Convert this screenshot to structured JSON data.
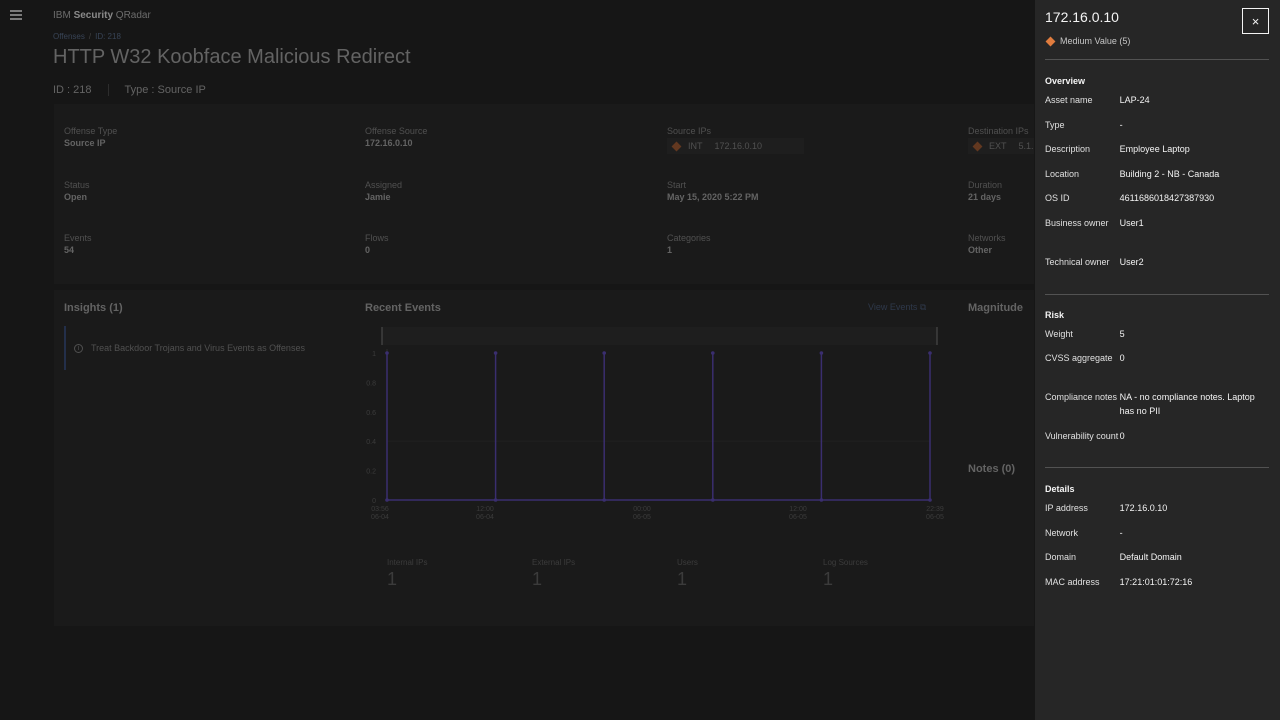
{
  "app": {
    "brand_prefix": "IBM ",
    "brand_bold": "Security",
    "brand_suffix": " QRadar"
  },
  "breadcrumb": {
    "root": "Offenses",
    "separator": "/",
    "current": "ID: 218"
  },
  "offense": {
    "title": "HTTP W32 Koobface Malicious Redirect",
    "id_label": "ID : 218",
    "type_label": "Type : Source IP",
    "fields": {
      "offense_type": {
        "label": "Offense Type",
        "value": "Source IP"
      },
      "offense_source": {
        "label": "Offense Source",
        "value": "172.16.0.10"
      },
      "source_ips": {
        "label": "Source IPs",
        "kind": "INT",
        "value": "172.16.0.10"
      },
      "destination_ips": {
        "label": "Destination IPs",
        "kind": "EXT",
        "value": "5.1..."
      },
      "status": {
        "label": "Status",
        "value": "Open"
      },
      "assigned": {
        "label": "Assigned",
        "value": "Jamie"
      },
      "start": {
        "label": "Start",
        "value": "May 15, 2020 5:22 PM"
      },
      "duration": {
        "label": "Duration",
        "value": "21 days"
      },
      "events": {
        "label": "Events",
        "value": "54"
      },
      "flows": {
        "label": "Flows",
        "value": "0"
      },
      "categories": {
        "label": "Categories",
        "value": "1"
      },
      "networks": {
        "label": "Networks",
        "value": "Other"
      }
    }
  },
  "insights": {
    "heading": "Insights (1)",
    "item": "Treat Backdoor Trojans and Virus Events as Offenses"
  },
  "recent_events": {
    "heading": "Recent Events",
    "view_link": "View Events"
  },
  "magnitude": {
    "heading": "Magnitude"
  },
  "notes": {
    "heading": "Notes (0)"
  },
  "stats": [
    {
      "label": "Internal IPs",
      "value": "1"
    },
    {
      "label": "External IPs",
      "value": "1"
    },
    {
      "label": "Users",
      "value": "1"
    },
    {
      "label": "Log Sources",
      "value": "1"
    }
  ],
  "chart_data": {
    "type": "line",
    "y_ticks": [
      "0",
      "0.2",
      "0.4",
      "0.6",
      "0.8",
      "1"
    ],
    "ylim": [
      0,
      1
    ],
    "x_ticks": [
      {
        "time": "03:56",
        "date": "06-04"
      },
      {
        "time": "12:00",
        "date": "06-04"
      },
      {
        "time": "00:00",
        "date": "06-05"
      },
      {
        "time": "12:00",
        "date": "06-05"
      },
      {
        "time": "22:39",
        "date": "06-05"
      }
    ],
    "series": [
      {
        "spikes_at_fraction": [
          0.0,
          0.2,
          0.4,
          0.6,
          0.8,
          1.0
        ],
        "spike_value": 1,
        "baseline": 0
      }
    ],
    "color": "#4d3b9e"
  },
  "panel": {
    "title": "172.16.0.10",
    "risk_label": "Medium Value (5)",
    "risk_color": "#e07c3e",
    "close_icon": "×",
    "overview": {
      "title": "Overview",
      "rows": [
        {
          "k": "Asset name",
          "v": "LAP-24"
        },
        {
          "k": "Type",
          "v": "-"
        },
        {
          "k": "Description",
          "v": "Employee Laptop"
        },
        {
          "k": "Location",
          "v": "Building 2 - NB - Canada"
        },
        {
          "k": "OS ID",
          "v": "4611686018427387930"
        },
        {
          "k": "Business owner",
          "v": "User1"
        },
        {
          "k": "Technical owner",
          "v": "User2"
        }
      ]
    },
    "risk": {
      "title": "Risk",
      "rows": [
        {
          "k": "Weight",
          "v": "5"
        },
        {
          "k": "CVSS aggregate",
          "v": "0"
        },
        {
          "k": "Compliance notes",
          "v": "NA - no compliance notes. Laptop has no PII"
        },
        {
          "k": "Vulnerability count",
          "v": "0"
        }
      ]
    },
    "details": {
      "title": "Details",
      "rows": [
        {
          "k": "IP address",
          "v": "172.16.0.10"
        },
        {
          "k": "Network",
          "v": "-"
        },
        {
          "k": "Domain",
          "v": "Default Domain"
        },
        {
          "k": "MAC address",
          "v": "17:21:01:01:72:16"
        }
      ]
    }
  }
}
